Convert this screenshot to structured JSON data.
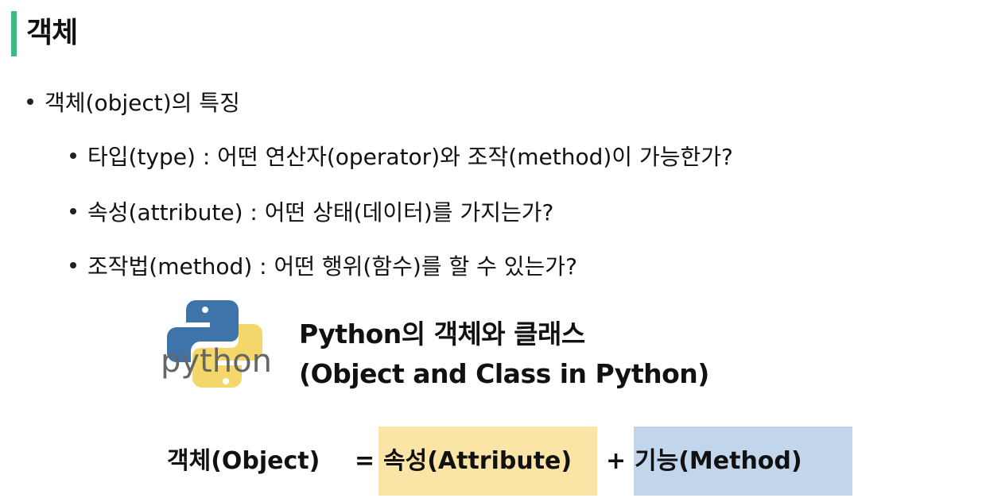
{
  "title": "객체",
  "accent_color": "#3dba83",
  "bullet_main": "객체(object)의 특징",
  "sub_bullets": [
    "타입(type) : 어떤 연산자(operator)와 조작(method)이 가능한가?",
    "속성(attribute) : 어떤 상태(데이터)를 가지는가?",
    "조작법(method) : 어떤 행위(함수)를 할 수 있는가?"
  ],
  "logo": {
    "icon": "python-logo-icon",
    "text": "python"
  },
  "python_title": {
    "line1": "Python의 객체와 클래스",
    "line2": "(Object and Class in Python)"
  },
  "equation": {
    "lhs": "객체(Object)",
    "equals": "=",
    "attribute": "속성(Attribute)",
    "plus": "+",
    "method": "기능(Method)",
    "attribute_color": "#fbe5a6",
    "method_color": "#c1d5eb"
  }
}
